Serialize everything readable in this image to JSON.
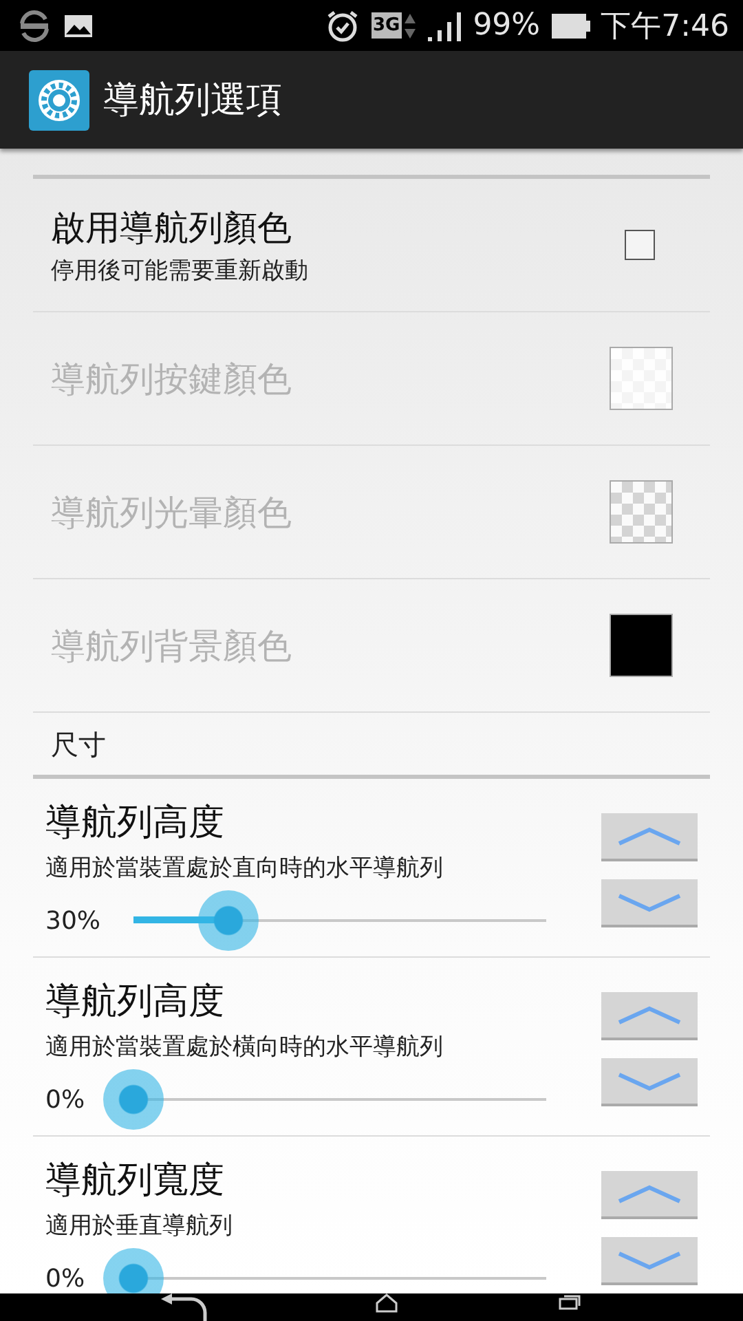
{
  "status_bar": {
    "network": "3G",
    "battery": "99%",
    "time": "下午7:46"
  },
  "app_bar": {
    "title": "導航列選項"
  },
  "color_items": [
    {
      "kind": "checkbox",
      "title": "啟用導航列顏色",
      "summary": "停用後可能需要重新啟動",
      "checked": false,
      "disabled": false
    },
    {
      "kind": "swatch",
      "title": "導航列按鍵顏色",
      "transparent": true,
      "color": "#ffffff",
      "disabled": true
    },
    {
      "kind": "swatch",
      "title": "導航列光暈顏色",
      "transparent": true,
      "disabled": true
    },
    {
      "kind": "swatch",
      "title": "導航列背景顏色",
      "transparent": false,
      "color": "#000000",
      "disabled": true
    }
  ],
  "size_section": {
    "title": "尺寸"
  },
  "size_items": [
    {
      "title": "導航列高度",
      "summary": "適用於當裝置處於直向時的水平導航列",
      "reading": "30%",
      "level": 0.23
    },
    {
      "title": "導航列高度",
      "summary": "適用於當裝置處於橫向時的水平導航列",
      "reading": "0%",
      "level": 0
    },
    {
      "title": "導航列寬度",
      "summary": "適用於垂直導航列",
      "reading": "0%",
      "level": 0
    }
  ]
}
